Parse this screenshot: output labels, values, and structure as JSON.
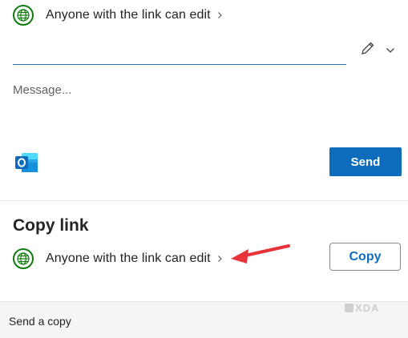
{
  "share": {
    "permission_text": "Anyone with the link can edit",
    "recipient_value": "",
    "message_placeholder": "Message...",
    "send_label": "Send"
  },
  "copy_link": {
    "heading": "Copy link",
    "permission_text": "Anyone with the link can edit",
    "copy_label": "Copy"
  },
  "footer": {
    "send_copy_label": "Send a copy",
    "watermark": "XDA"
  },
  "icons": {
    "globe": "globe-icon",
    "chevron": "chevron-right-icon",
    "pencil": "pencil-icon",
    "dropdown": "chevron-down-icon",
    "outlook": "outlook-icon",
    "arrow": "arrow-annotation"
  },
  "colors": {
    "accent": "#0f6cbd",
    "globe_green": "#107c10",
    "arrow_red": "#e8333a"
  }
}
